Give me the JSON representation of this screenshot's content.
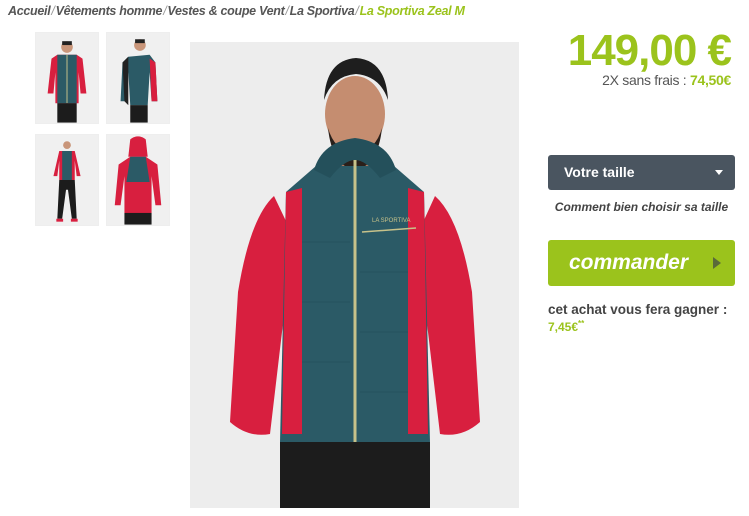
{
  "breadcrumb": {
    "items": [
      "Accueil",
      "Vêtements homme",
      "Vestes & coupe Vent",
      "La Sportiva"
    ],
    "current": "La Sportiva Zeal M",
    "separator": "/"
  },
  "gallery": {
    "thumbnails": [
      "front-view",
      "side-view",
      "full-body-view",
      "back-view"
    ],
    "main_image": "front-view"
  },
  "product": {
    "price": "149,00 €",
    "installment_prefix": "2X sans frais : ",
    "installment_amount": "74,50€"
  },
  "size": {
    "label": "Votre taille",
    "help_link": "Comment bien choisir sa taille"
  },
  "order": {
    "button_label": "commander"
  },
  "reward": {
    "text": "cet achat vous fera gagner :",
    "amount": "7,45€",
    "note": "**"
  },
  "colors": {
    "accent_green": "#9bc31c",
    "select_bg": "#4a5560",
    "jacket_red": "#d81f3f",
    "jacket_teal": "#2b5a66"
  }
}
